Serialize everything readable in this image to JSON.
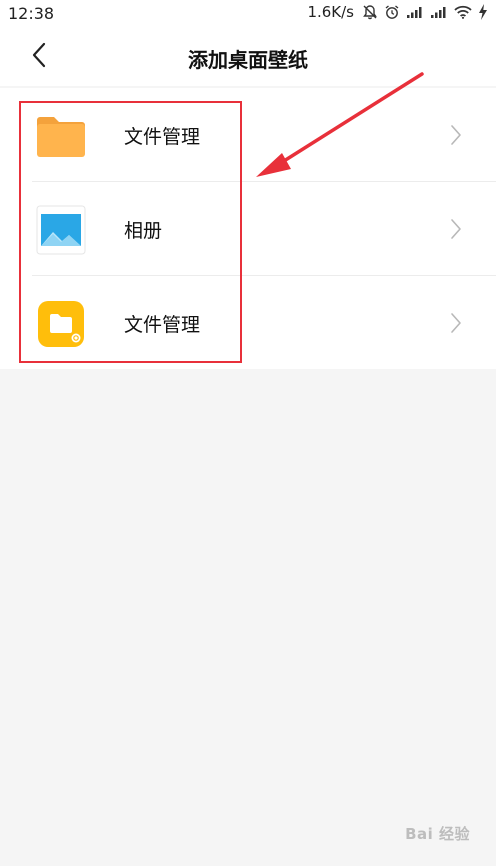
{
  "status_bar": {
    "time": "12:38",
    "net_speed": "1.6K/s",
    "icons": [
      "mute-icon",
      "alarm-icon",
      "signal-icon",
      "signal-icon",
      "wifi-icon",
      "charging-icon"
    ]
  },
  "header": {
    "title": "添加桌面壁纸",
    "back_icon": "chevron-left-icon"
  },
  "list": {
    "items": [
      {
        "label": "文件管理",
        "icon": "folder-icon"
      },
      {
        "label": "相册",
        "icon": "gallery-icon"
      },
      {
        "label": "文件管理",
        "icon": "file-manager-app-icon"
      }
    ]
  },
  "colors": {
    "folder_orange": "#ffb44d",
    "gallery_blue": "#2aa7e6",
    "file_manager_yellow": "#ffbe0b",
    "annotation_red": "#e8303a"
  },
  "watermark": {
    "text": "Bai 经验"
  }
}
